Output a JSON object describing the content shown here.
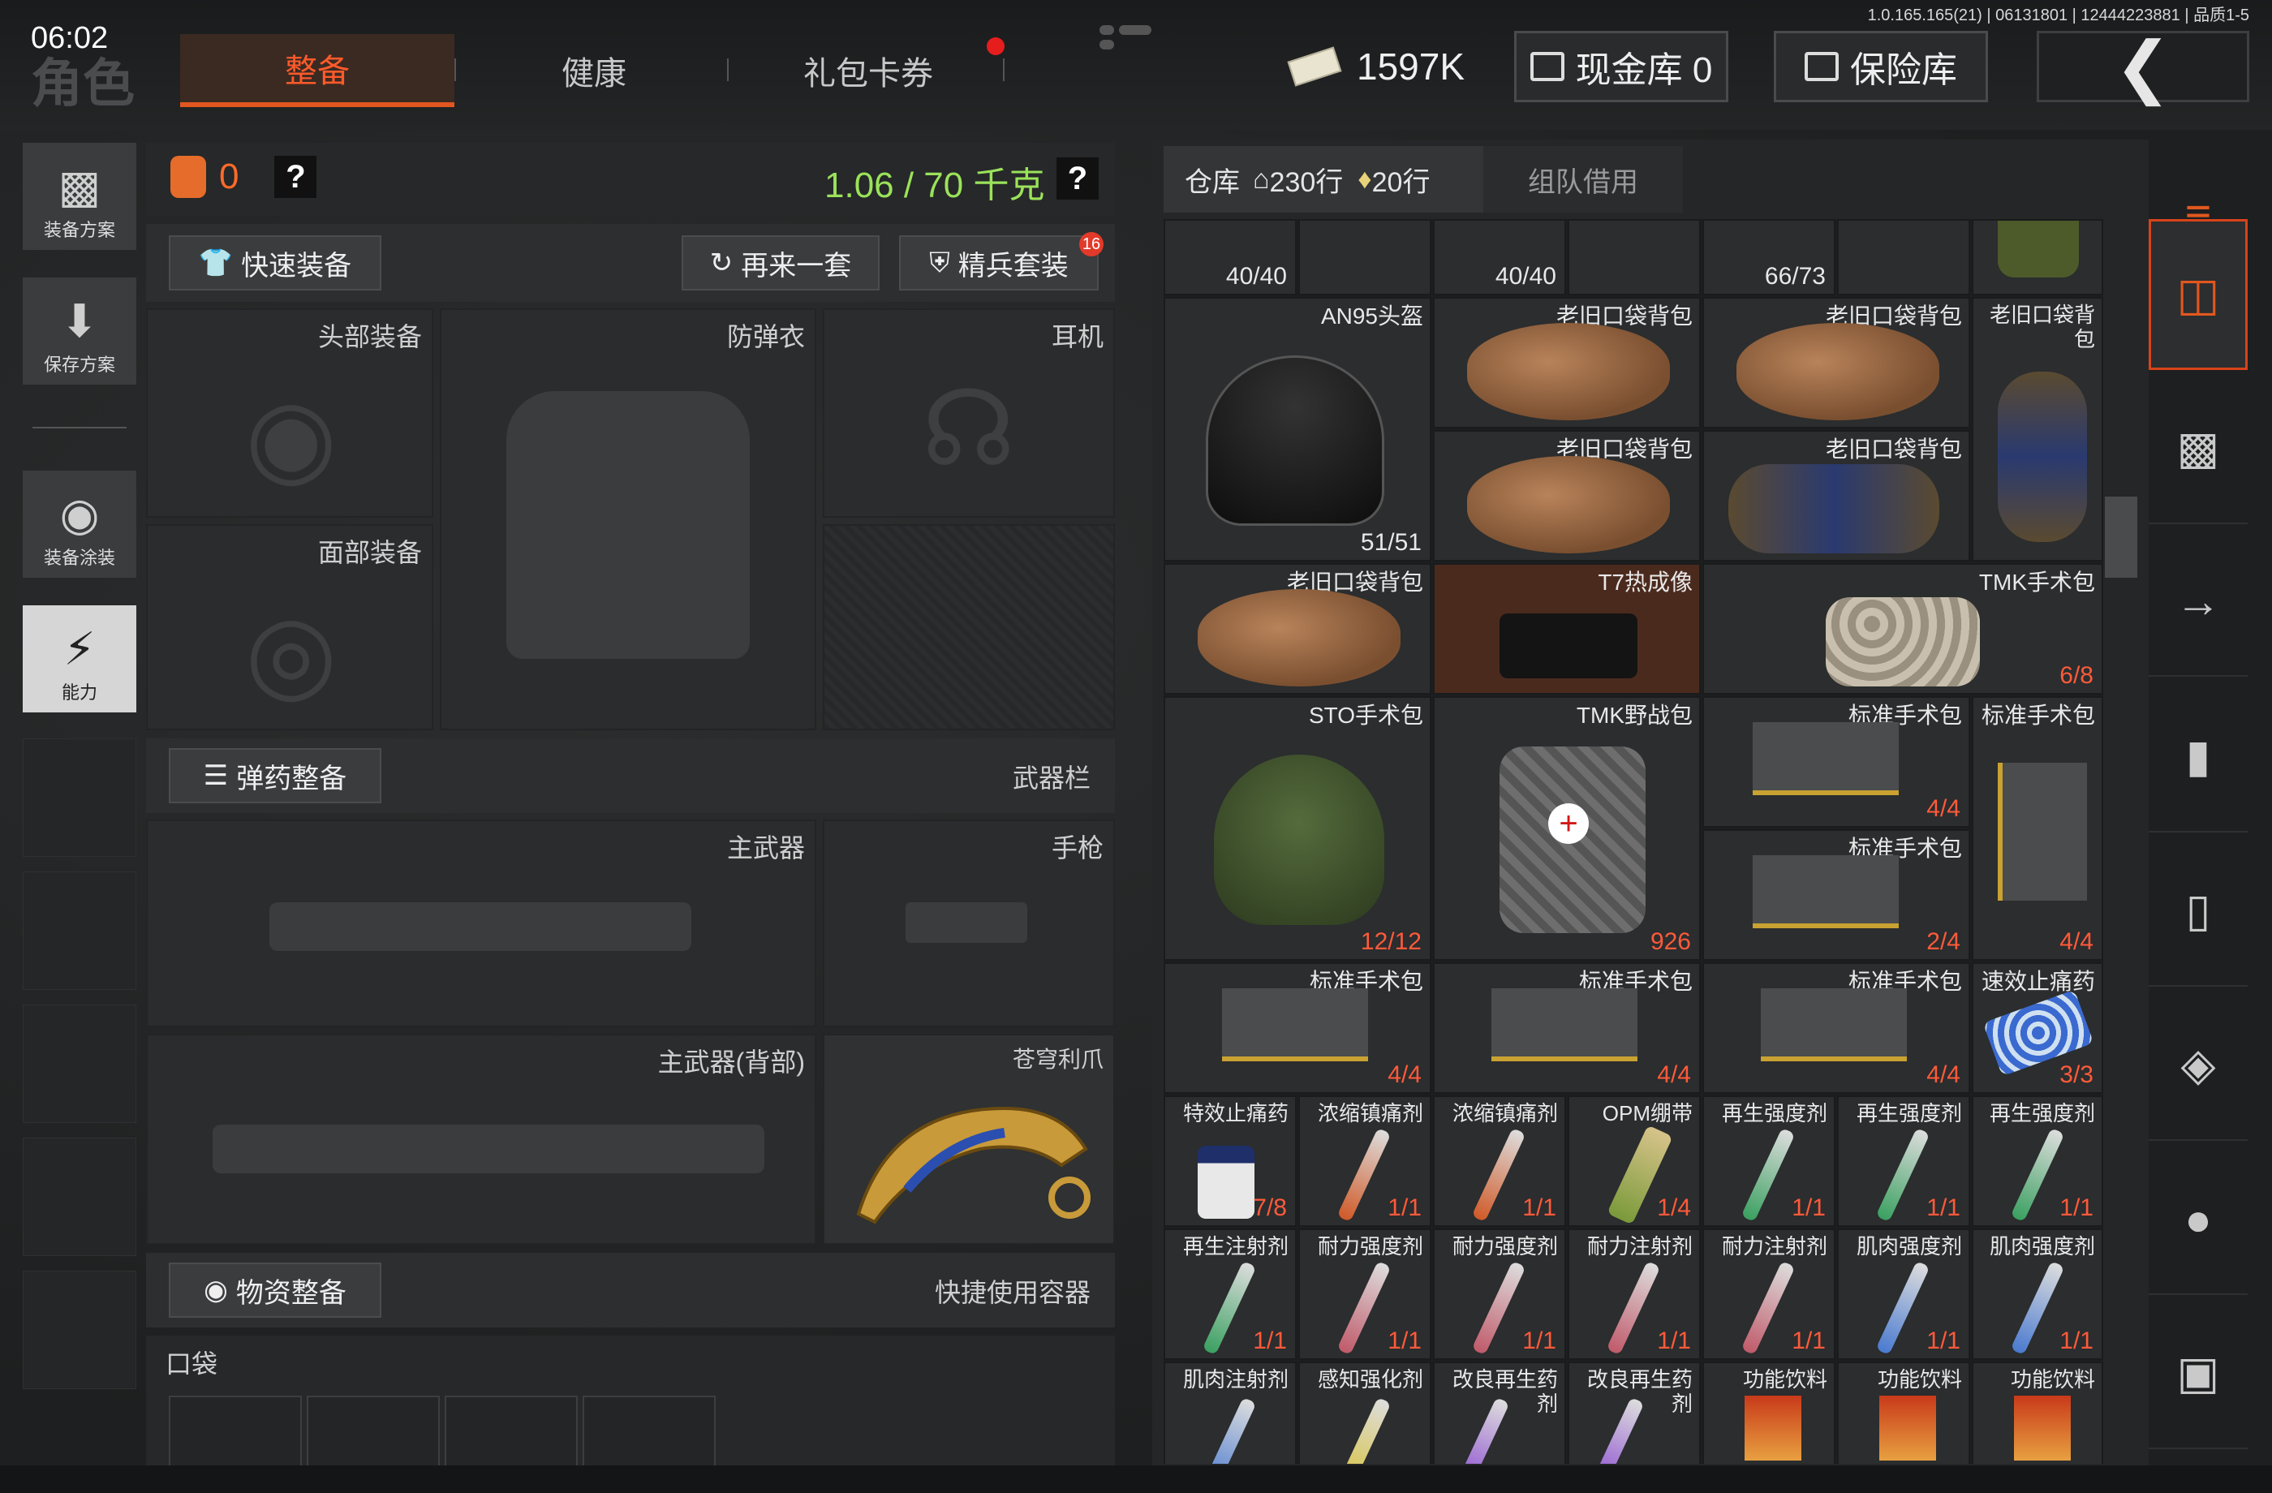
{
  "status": {
    "time": "06:02",
    "version": "1.0.165.165(21) | 06131801 | 12444223881 | 品质1-5"
  },
  "header": {
    "role_label": "角色",
    "tabs": [
      {
        "label": "整备",
        "active": true
      },
      {
        "label": "健康"
      },
      {
        "label": "礼包卡券"
      }
    ],
    "money": "1597K",
    "cash_vault": "现金库 0",
    "safe_box": "保险库"
  },
  "leftnav": [
    {
      "label": "装备方案",
      "icon": "vest-icon"
    },
    {
      "label": "保存方案",
      "icon": "download-icon"
    },
    {
      "label": "装备涂装",
      "icon": "helmet-paint-icon"
    },
    {
      "label": "能力",
      "icon": "lightning-icon",
      "active": true
    }
  ],
  "equip": {
    "level": "0",
    "weight": "1.06 / 70 千克",
    "help": "?",
    "quick_equip": "快速装备",
    "again": "再来一套",
    "elite": "精兵套装",
    "elite_badge": "16",
    "slots": {
      "head": "头部装备",
      "armor": "防弹衣",
      "earphone": "耳机",
      "face": "面部装备",
      "ammo_btn": "弹药整备",
      "weapon_bar": "武器栏",
      "primary": "主武器",
      "pistol": "手枪",
      "primary_back": "主武器(背部)",
      "melee": "苍穹利爪",
      "supply_btn": "物资整备",
      "quick_container": "快捷使用容器",
      "pocket": "口袋"
    }
  },
  "warehouse": {
    "tab": "仓库",
    "rows_home": "230行",
    "rows_2": "20行",
    "team": "组队借用",
    "items": [
      {
        "name": "",
        "count": "40/40"
      },
      {
        "name": "",
        "count": "40/40"
      },
      {
        "name": "",
        "count": "66/73"
      },
      {
        "name": "",
        "count": ""
      },
      {
        "name": "AN95头盔",
        "count": "51/51"
      },
      {
        "name": "老旧口袋背包",
        "count": ""
      },
      {
        "name": "老旧口袋背包",
        "count": ""
      },
      {
        "name": "老旧口袋背包",
        "count": ""
      },
      {
        "name": "老旧口袋背包",
        "count": ""
      },
      {
        "name": "老旧口袋背包",
        "count": ""
      },
      {
        "name": "老旧口袋背包",
        "count": ""
      },
      {
        "name": "T7热成像",
        "count": ""
      },
      {
        "name": "TMK手术包",
        "count": "6/8"
      },
      {
        "name": "STO手术包",
        "count": "12/12"
      },
      {
        "name": "TMK野战包",
        "count": "926"
      },
      {
        "name": "标准手术包",
        "count": "4/4"
      },
      {
        "name": "标准手术包",
        "count": "4/4"
      },
      {
        "name": "标准手术包",
        "count": "2/4"
      },
      {
        "name": "标准手术包",
        "count": "4/4"
      },
      {
        "name": "标准手术包",
        "count": "4/4"
      },
      {
        "name": "标准手术包",
        "count": "4/4"
      },
      {
        "name": "速效止痛药",
        "count": "3/3"
      },
      {
        "name": "特效止痛药",
        "count": "7/8"
      },
      {
        "name": "浓缩镇痛剂",
        "count": "1/1"
      },
      {
        "name": "浓缩镇痛剂",
        "count": "1/1"
      },
      {
        "name": "OPM绷带",
        "count": "1/4"
      },
      {
        "name": "再生强度剂",
        "count": "1/1"
      },
      {
        "name": "再生强度剂",
        "count": "1/1"
      },
      {
        "name": "再生强度剂",
        "count": "1/1"
      },
      {
        "name": "再生注射剂",
        "count": "1/1"
      },
      {
        "name": "耐力强度剂",
        "count": "1/1"
      },
      {
        "name": "耐力强度剂",
        "count": "1/1"
      },
      {
        "name": "耐力注射剂",
        "count": "1/1"
      },
      {
        "name": "耐力注射剂",
        "count": "1/1"
      },
      {
        "name": "肌肉强度剂",
        "count": "1/1"
      },
      {
        "name": "肌肉强度剂",
        "count": "1/1"
      },
      {
        "name": "肌肉注射剂",
        "count": ""
      },
      {
        "name": "感知强化剂",
        "count": ""
      },
      {
        "name": "改良再生药剂",
        "count": ""
      },
      {
        "name": "改良再生药剂",
        "count": ""
      },
      {
        "name": "功能饮料",
        "count": ""
      },
      {
        "name": "功能饮料",
        "count": ""
      },
      {
        "name": "功能饮料",
        "count": ""
      }
    ]
  },
  "rightbar": [
    "sort-icon",
    "storage-icon",
    "vest-icon",
    "rifle-icon",
    "magazine-icon",
    "ammo-icon",
    "armor-icon",
    "grenade-icon",
    "misc-icon"
  ],
  "colors": {
    "accent": "#e2571f",
    "weight": "#9be25a",
    "count_red": "#ff5a3a"
  }
}
